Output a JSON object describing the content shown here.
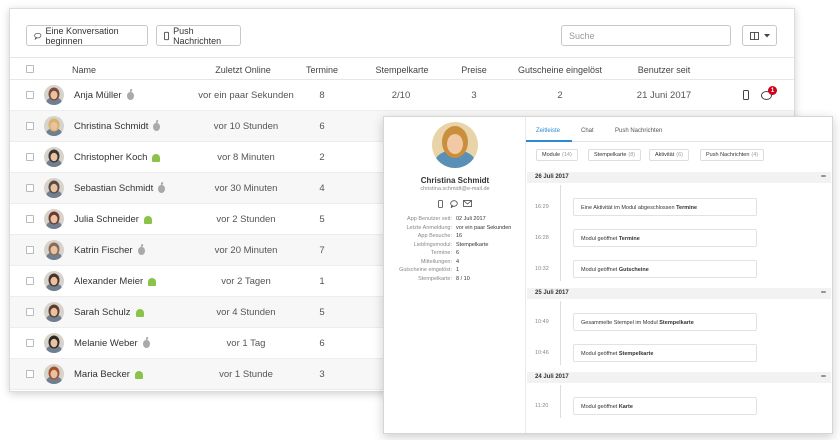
{
  "toolbar": {
    "start_conversation": "Eine Konversation beginnen",
    "push_messages": "Push Nachrichten",
    "search_placeholder": "Suche"
  },
  "table": {
    "headers": [
      "Name",
      "Zuletzt Online",
      "Termine",
      "Stempelkarte",
      "Preise",
      "Gutscheine eingelöst",
      "Benutzer seit"
    ],
    "rows": [
      {
        "name": "Anja Müller",
        "os": "apple",
        "last_online": "vor ein paar Sekunden",
        "termine": "8",
        "stempelkarte": "2/10",
        "preise": "3",
        "gutscheine": "2",
        "seit": "21 Juni 2017",
        "badge": "1",
        "avatar_color": "#7a4b3a"
      },
      {
        "name": "Christina Schmidt",
        "os": "apple",
        "last_online": "vor 10 Stunden",
        "termine": "6",
        "avatar_color": "#d9b26a"
      },
      {
        "name": "Christopher Koch",
        "os": "android",
        "last_online": "vor 8 Minuten",
        "termine": "2",
        "avatar_color": "#3d3530"
      },
      {
        "name": "Sebastian Schmidt",
        "os": "apple",
        "last_online": "vor 30 Minuten",
        "termine": "4",
        "avatar_color": "#5a4a42"
      },
      {
        "name": "Julia Schneider",
        "os": "android",
        "last_online": "vor 2 Stunden",
        "termine": "5",
        "avatar_color": "#6b3a2e"
      },
      {
        "name": "Katrin Fischer",
        "os": "apple",
        "last_online": "vor 20 Minuten",
        "termine": "7",
        "avatar_color": "#8a6a55"
      },
      {
        "name": "Alexander Meier",
        "os": "android",
        "last_online": "vor 2 Tagen",
        "termine": "1",
        "avatar_color": "#4a3328"
      },
      {
        "name": "Sarah Schulz",
        "os": "android",
        "last_online": "vor 4 Stunden",
        "termine": "5",
        "avatar_color": "#5c3d2e"
      },
      {
        "name": "Melanie Weber",
        "os": "apple",
        "last_online": "vor 1 Tag",
        "termine": "6",
        "avatar_color": "#2e2622"
      },
      {
        "name": "Maria Becker",
        "os": "android",
        "last_online": "vor 1 Stunde",
        "termine": "3",
        "avatar_color": "#a0522d"
      }
    ]
  },
  "profile": {
    "name": "Christina Schmidt",
    "email": "christina.schmidt@e-mail.de",
    "stats": [
      {
        "k": "App Benutzer seit:",
        "v": "02 Juli 2017"
      },
      {
        "k": "Letzte Anmeldung:",
        "v": "vor ein paar Sekunden"
      },
      {
        "k": "App Besuche:",
        "v": "16"
      },
      {
        "k": "Lieblingsmodul:",
        "v": "Stempelkarte"
      },
      {
        "k": "Termine:",
        "v": "6"
      },
      {
        "k": "Mitteilungen:",
        "v": "4"
      },
      {
        "k": "Gutscheine eingelöst:",
        "v": "1"
      },
      {
        "k": "Stempelkarte:",
        "v": "8 / 10"
      }
    ]
  },
  "panel_tabs": [
    "Zeitleiste",
    "Chat",
    "Push Nachrichten"
  ],
  "filters": [
    {
      "label": "Module",
      "count": "(14)"
    },
    {
      "label": "Stempelkarte",
      "count": "(8)"
    },
    {
      "label": "Aktivität",
      "count": "(6)"
    },
    {
      "label": "Push Nachrichten",
      "count": "(4)"
    }
  ],
  "timeline": {
    "day1": {
      "date": "26 Juli 2017",
      "events": [
        {
          "time": "16:29",
          "text": "Eine Aktivität im Modul abgeschlossen",
          "bold": "Termine"
        },
        {
          "time": "16:28",
          "text": "Modul geöffnet",
          "bold": "Termine"
        },
        {
          "time": "10:32",
          "text": "Modul geöffnet",
          "bold": "Gutscheine"
        }
      ]
    },
    "day2": {
      "date": "25 Juli 2017",
      "events": [
        {
          "time": "10:49",
          "text": "Gesammelte Stempel im Modul",
          "bold": "Stempelkarte"
        },
        {
          "time": "10:46",
          "text": "Modul geöffnet",
          "bold": "Stempelkarte"
        }
      ]
    },
    "day3": {
      "date": "24 Juli 2017",
      "events": [
        {
          "time": "11:20",
          "text": "Modul geöffnet",
          "bold": "Karte"
        }
      ]
    },
    "collapse_symbol": "−"
  },
  "colors": {
    "accent": "#2a8bd6",
    "badge": "#d0021b",
    "android": "#8bc34a",
    "apple": "#aaaaaa"
  }
}
